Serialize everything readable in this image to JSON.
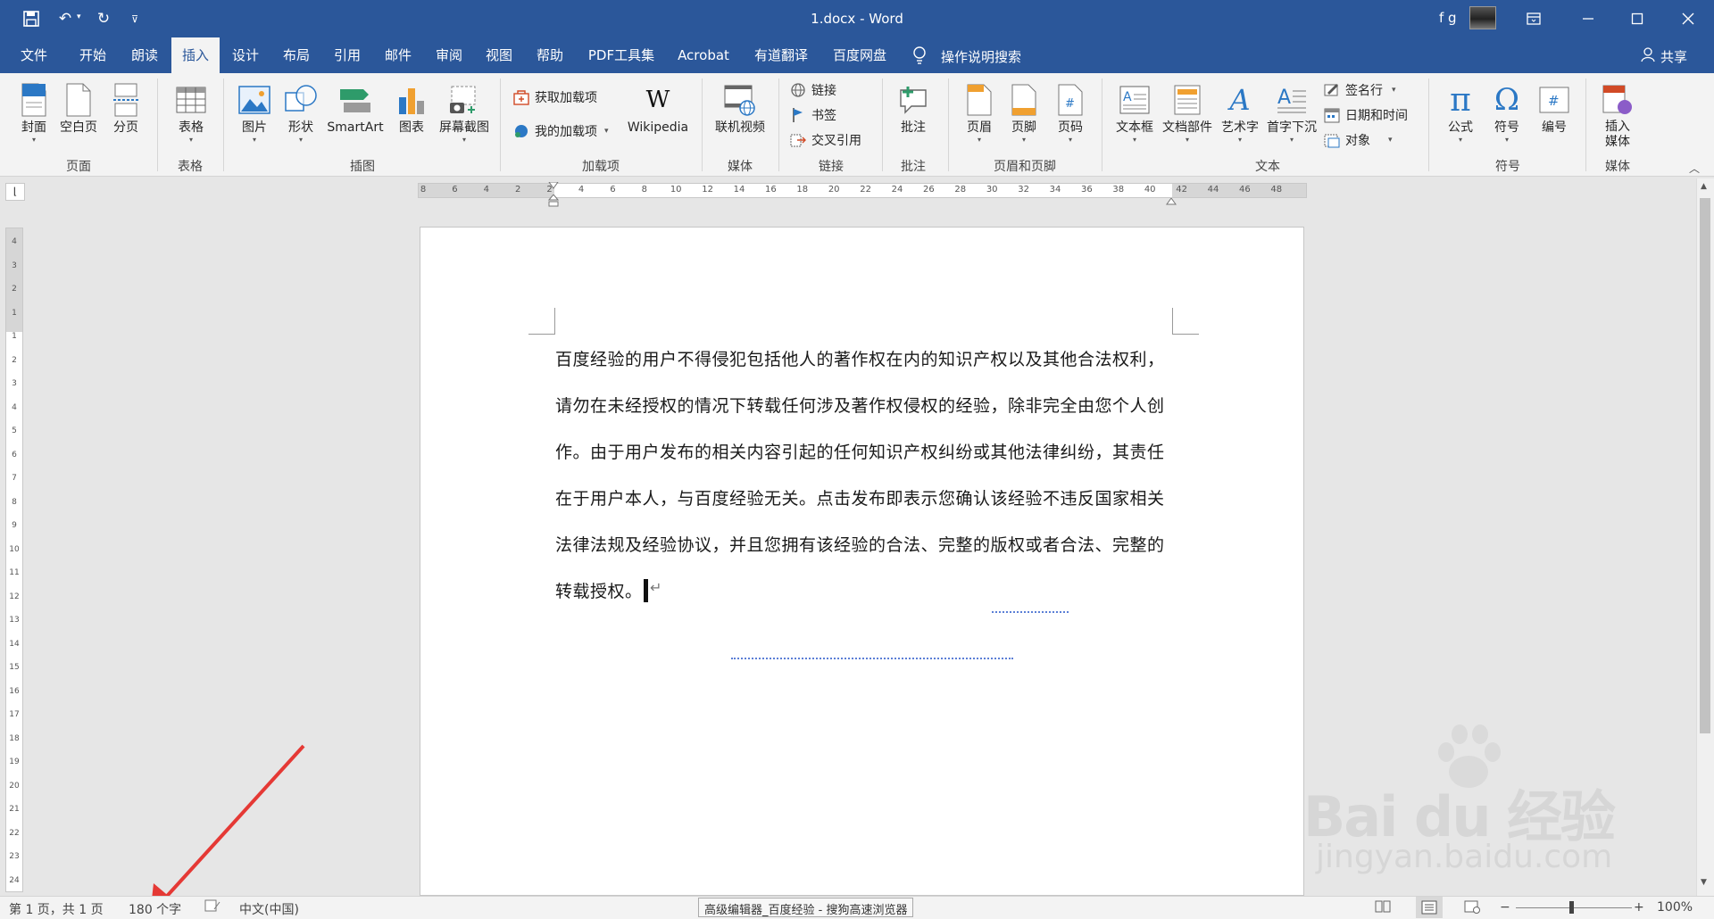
{
  "title": {
    "document": "1.docx",
    "separator": "-",
    "app": "Word",
    "user": "f g"
  },
  "tabs": [
    "文件",
    "开始",
    "朗读",
    "插入",
    "设计",
    "布局",
    "引用",
    "邮件",
    "审阅",
    "视图",
    "帮助",
    "PDF工具集",
    "Acrobat",
    "有道翻译",
    "百度网盘"
  ],
  "search": {
    "label": "操作说明搜索"
  },
  "share": "共享",
  "ribbon": {
    "pages": {
      "cover": "封面",
      "blank": "空白页",
      "break": "分页",
      "group": "页面"
    },
    "table": {
      "table": "表格",
      "group": "表格"
    },
    "illustrations": {
      "picture": "图片",
      "shapes": "形状",
      "smartart": "SmartArt",
      "chart": "图表",
      "screenshot": "屏幕截图",
      "group": "插图"
    },
    "addins": {
      "get": "获取加载项",
      "mine": "我的加载项",
      "wikipedia": "Wikipedia",
      "group": "加载项"
    },
    "media": {
      "video": "联机视频",
      "group": "媒体"
    },
    "links": {
      "link": "链接",
      "bookmark": "书签",
      "crossref": "交叉引用",
      "group": "链接"
    },
    "comments": {
      "comment": "批注",
      "group": "批注"
    },
    "headerfooter": {
      "header": "页眉",
      "footer": "页脚",
      "pagenum": "页码",
      "group": "页眉和页脚"
    },
    "text": {
      "textbox": "文本框",
      "parts": "文档部件",
      "wordart": "艺术字",
      "dropcap": "首字下沉",
      "signature": "签名行",
      "datetime": "日期和时间",
      "object": "对象",
      "group": "文本"
    },
    "symbols": {
      "equation": "公式",
      "symbol": "符号",
      "number": "编号",
      "group": "符号"
    },
    "media2": {
      "insert": "插入",
      "media": "媒体",
      "group": "媒体"
    }
  },
  "ruler": {
    "h_ticks": [
      "8",
      "6",
      "4",
      "2",
      "2",
      "4",
      "6",
      "8",
      "10",
      "12",
      "14",
      "16",
      "18",
      "20",
      "22",
      "24",
      "26",
      "28",
      "30",
      "32",
      "34",
      "36",
      "38",
      "40",
      "42",
      "44",
      "46",
      "48"
    ],
    "v_ticks": [
      "4",
      "3",
      "2",
      "1",
      "1",
      "2",
      "3",
      "4",
      "5",
      "6",
      "7",
      "8",
      "9",
      "10",
      "11",
      "12",
      "13",
      "14",
      "15",
      "16",
      "17",
      "18",
      "19",
      "20",
      "21",
      "22",
      "23",
      "24"
    ]
  },
  "document": {
    "lines": [
      "百度经验的用户不得侵犯包括他人的著作权在内的知识产权以及其他合法权利，",
      "请勿在未经授权的情况下转载任何涉及著作权侵权的经验，除非完全由您个人创",
      "作。由于用户发布的相关内容引起的任何知识产权纠纷或其他法律纠纷，其责任",
      "在于用户本人，与百度经验无关。点击发布即表示您确认该经验不违反国家相关",
      "法律法规及经验协议，并且您拥有该经验的合法、完整的版权或者合法、完整的",
      "转载授权。"
    ]
  },
  "status": {
    "page": "第 1 页，共 1 页",
    "words": "180 个字",
    "lang": "中文(中国)",
    "taskbar_tip": "高级编辑器_百度经验 - 搜狗高速浏览器",
    "zoom": "100%"
  },
  "watermark": {
    "brand": "Bai du 经验",
    "url": "jingyan.baidu.com"
  },
  "colors": {
    "accent": "#2b579a",
    "arrow": "#e53935"
  }
}
